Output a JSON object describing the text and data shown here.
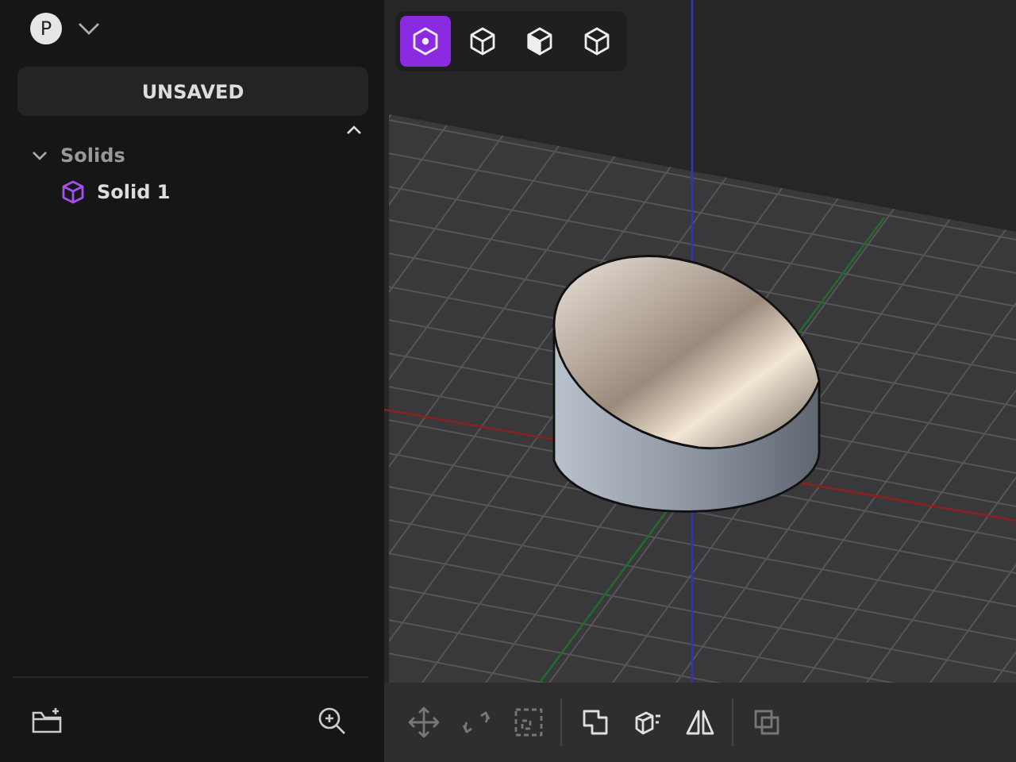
{
  "account": {
    "avatar_letter": "P"
  },
  "save_status": "UNSAVED",
  "tree": [
    {
      "label": "Solids",
      "expanded": true,
      "children": [
        {
          "label": "Solid 1"
        }
      ]
    }
  ],
  "view_buttons": [
    {
      "kind": "top",
      "selected": true
    },
    {
      "kind": "front",
      "selected": false
    },
    {
      "kind": "iso-shaded",
      "selected": false
    },
    {
      "kind": "iso",
      "selected": false
    }
  ],
  "tool_buttons": [
    {
      "kind": "move",
      "disabled": true
    },
    {
      "kind": "rotate",
      "disabled": true
    },
    {
      "kind": "scale",
      "disabled": true
    },
    {
      "kind": "union",
      "disabled": false
    },
    {
      "kind": "extrude",
      "disabled": false
    },
    {
      "kind": "mirror",
      "disabled": false
    },
    {
      "kind": "duplicate",
      "disabled": true
    }
  ]
}
